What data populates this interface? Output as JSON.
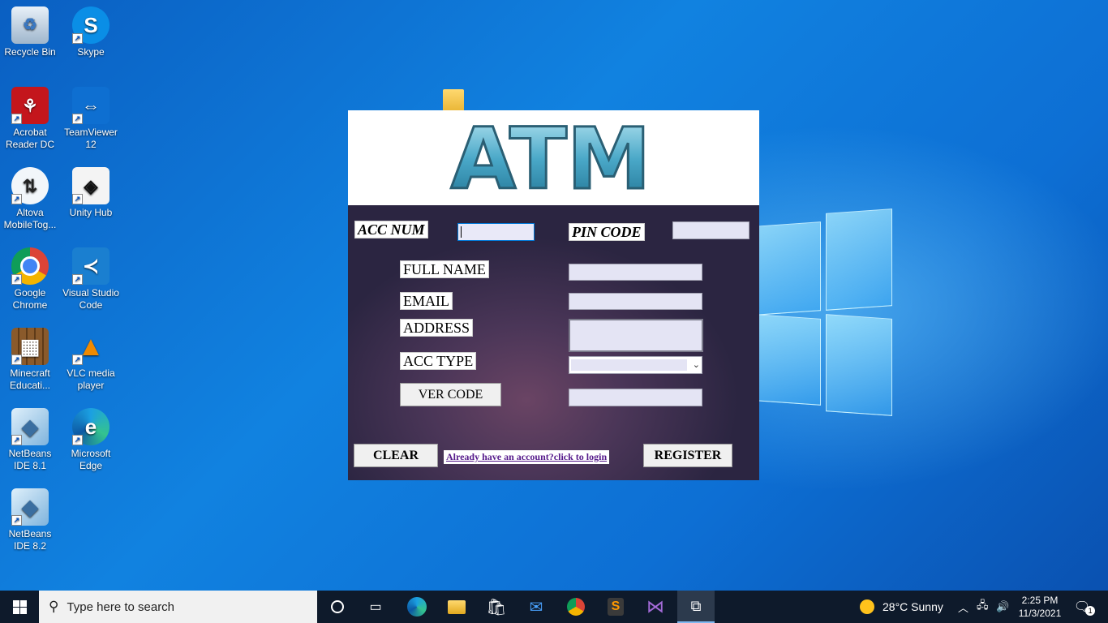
{
  "desktop": {
    "icons": [
      {
        "label": "Recycle Bin",
        "icon": "recycle-bin-icon"
      },
      {
        "label": "Skype",
        "icon": "skype-icon"
      },
      {
        "label": "Acrobat Reader DC",
        "icon": "acrobat-icon"
      },
      {
        "label": "TeamViewer 12",
        "icon": "teamviewer-icon"
      },
      {
        "label": "Altova MobileTog...",
        "icon": "altova-icon"
      },
      {
        "label": "Unity Hub",
        "icon": "unity-icon"
      },
      {
        "label": "Google Chrome",
        "icon": "chrome-icon"
      },
      {
        "label": "Visual Studio Code",
        "icon": "vscode-icon"
      },
      {
        "label": "Minecraft Educati...",
        "icon": "minecraft-icon"
      },
      {
        "label": "VLC media player",
        "icon": "vlc-icon"
      },
      {
        "label": "NetBeans IDE 8.1",
        "icon": "netbeans-icon"
      },
      {
        "label": "Microsoft Edge",
        "icon": "edge-icon"
      },
      {
        "label": "NetBeans IDE 8.2",
        "icon": "netbeans-icon"
      }
    ]
  },
  "atm": {
    "logo_text": "ATM",
    "labels": {
      "acc_num": "ACC NUM",
      "pin_code": "PIN CODE",
      "full_name": "FULL NAME",
      "email": "EMAIL",
      "address": "ADDRESS",
      "acc_type": "ACC TYPE"
    },
    "fields": {
      "acc_num": "",
      "pin_code": "",
      "full_name": "",
      "email": "",
      "address": "",
      "acc_type": "",
      "ver_code": ""
    },
    "buttons": {
      "ver_code": "VER CODE",
      "clear": "CLEAR",
      "register": "REGISTER"
    },
    "login_link": "Already have an account?click to login"
  },
  "taskbar": {
    "search_placeholder": "Type here to search",
    "weather": "28°C  Sunny",
    "time": "2:25 PM",
    "date": "11/3/2021",
    "notification_count": "1",
    "apps": [
      "task-view-icon",
      "edge-icon",
      "file-explorer-icon",
      "store-icon",
      "mail-icon",
      "chrome-icon",
      "sublime-icon",
      "visual-studio-icon",
      "java-app-icon"
    ]
  }
}
